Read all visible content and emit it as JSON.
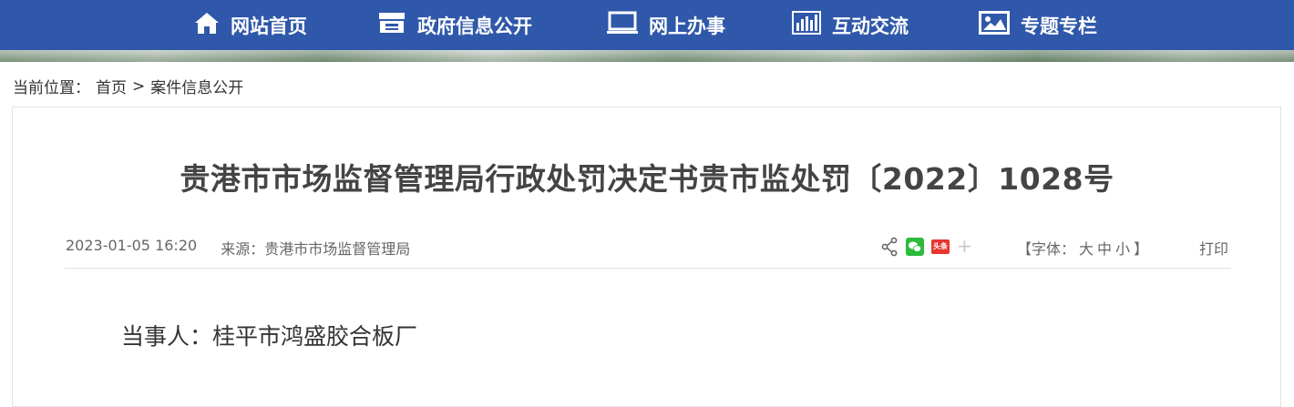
{
  "nav": {
    "items": [
      {
        "label": "网站首页",
        "icon": "home-icon"
      },
      {
        "label": "政府信息公开",
        "icon": "archive-icon"
      },
      {
        "label": "网上办事",
        "icon": "monitor-icon"
      },
      {
        "label": "互动交流",
        "icon": "bar-chart-icon"
      },
      {
        "label": "专题专栏",
        "icon": "image-icon"
      }
    ]
  },
  "breadcrumb": {
    "prefix": "当前位置：",
    "home": "首页",
    "separator": ">",
    "current": "案件信息公开"
  },
  "article": {
    "title": "贵港市市场监督管理局行政处罚决定书贵市监处罚〔2022〕1028号",
    "date": "2023-01-05 16:20",
    "source": "来源：贵港市市场监督管理局",
    "share_icons": [
      "share-icon",
      "wechat-icon",
      "toutiao-icon",
      "plus-icon"
    ],
    "toutiao_label": "头条",
    "font_label_open": "【字体：",
    "font_large": "大",
    "font_medium": "中",
    "font_small": "小",
    "font_label_close": "】",
    "print": "打印",
    "party": "当事人：桂平市鸿盛胶合板厂"
  },
  "colors": {
    "nav_bg": "#2f58aa",
    "wechat": "#2dbb3c",
    "toutiao": "#e8352f"
  }
}
